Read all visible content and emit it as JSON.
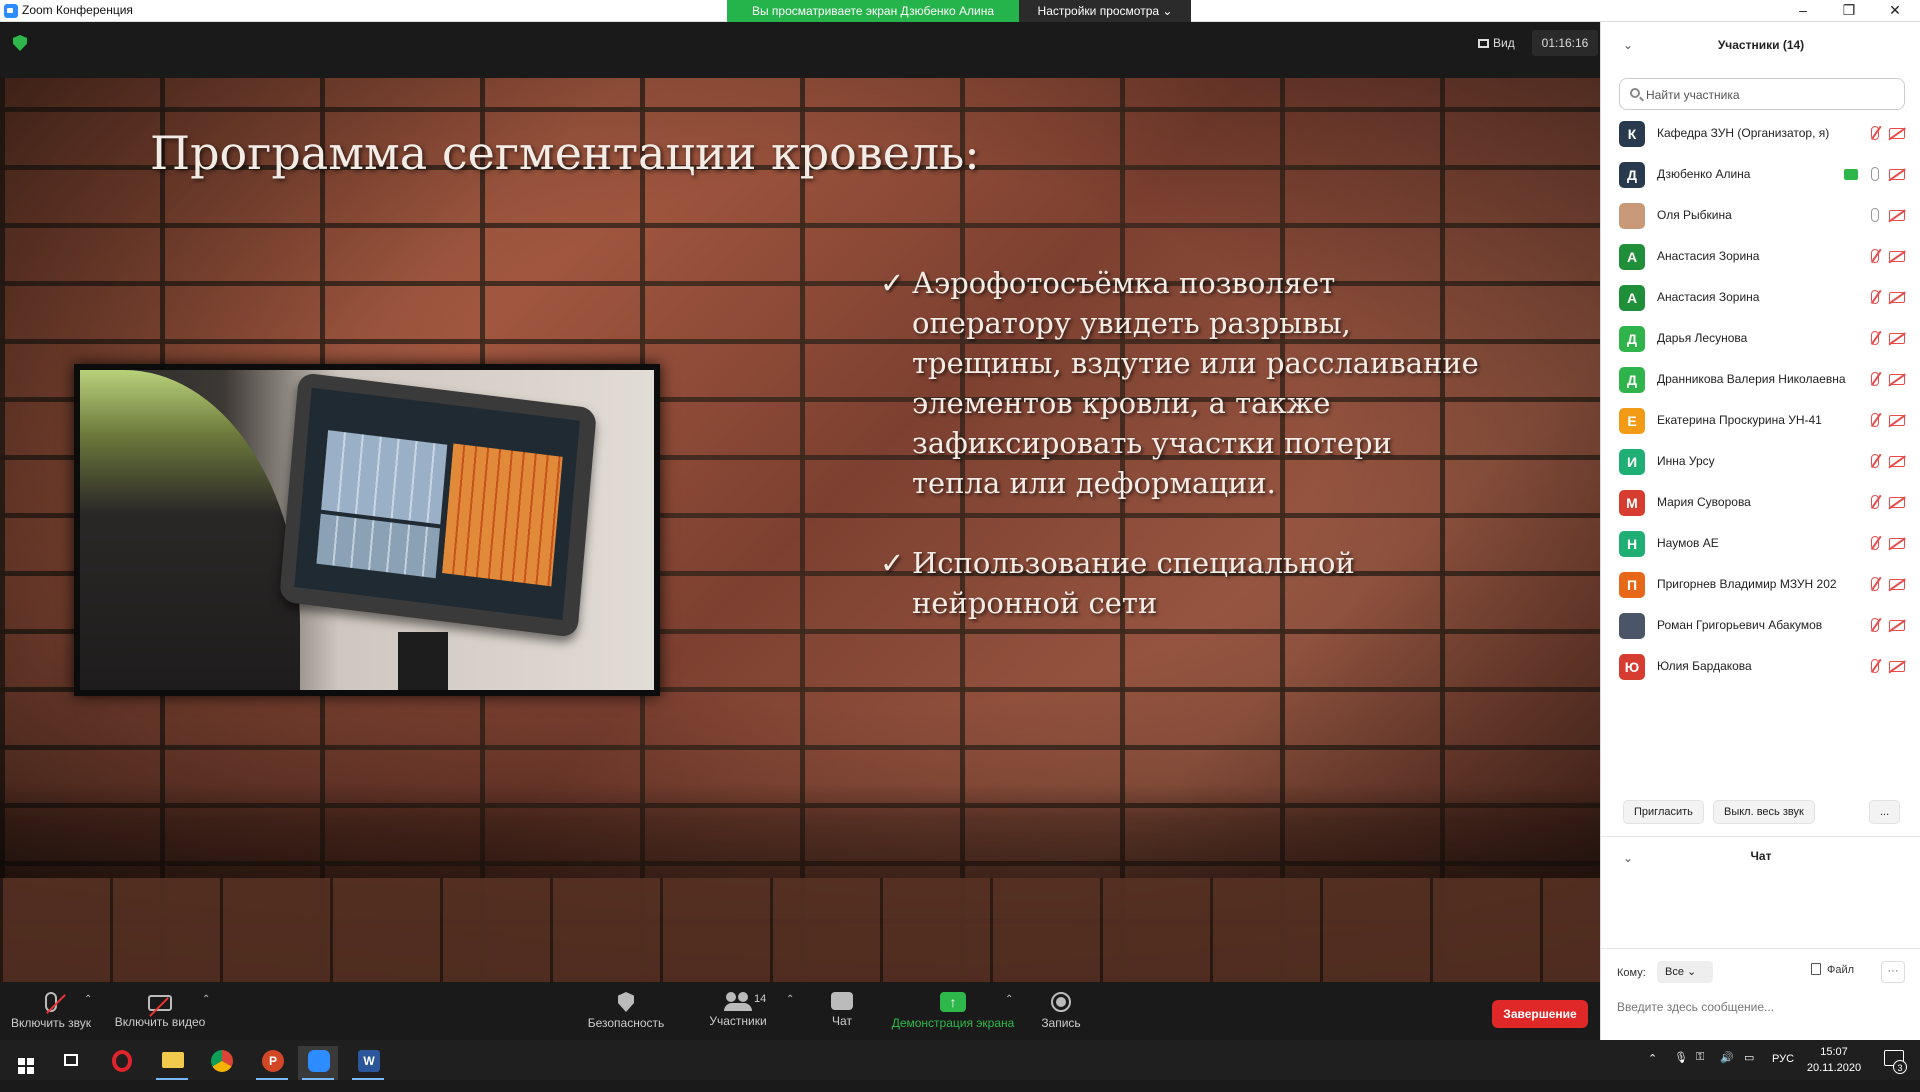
{
  "window": {
    "title": "Zoom Конференция"
  },
  "share_banner": {
    "status": "Вы просматриваете экран Дзюбенко Алина",
    "view_settings": "Настройки просмотра ⌄"
  },
  "meeting": {
    "view_label": "Вид",
    "timer": "01:16:16"
  },
  "slide": {
    "title": "Программа сегментации кровель:",
    "check_glyph": "✓",
    "bullets": [
      {
        "text": "Аэрофотосъёмка позволяет оператору увидеть разрывы, трещины, вздутие или расслаивание элементов кровли, а также зафиксировать участки потери тепла или деформации."
      },
      {
        "text": "Использование специальной нейронной сети"
      }
    ]
  },
  "toolbar": {
    "unmute": "Включить звук",
    "start_video": "Включить видео",
    "security": "Безопасность",
    "participants": "Участники",
    "participants_count": "14",
    "chat": "Чат",
    "share_screen": "Демонстрация экрана",
    "record": "Запись",
    "end": "Завершение"
  },
  "panel": {
    "title": "Участники (14)",
    "search_placeholder": "Найти участника",
    "participants": [
      {
        "initial": "К",
        "name": "Кафедра ЗУН (Организатор, я)",
        "color": "#2a3a4e",
        "mic": "muted"
      },
      {
        "initial": "Д",
        "name": "Дзюбенко Алина",
        "color": "#2a3a4e",
        "mic": "on",
        "sharing": true
      },
      {
        "initial": "",
        "name": "Оля Рыбкина",
        "color": "#c99a7a",
        "mic": "on"
      },
      {
        "initial": "А",
        "name": "Анастасия Зорина",
        "color": "#1f8f3a",
        "mic": "muted"
      },
      {
        "initial": "А",
        "name": "Анастасия Зорина",
        "color": "#1f8f3a",
        "mic": "muted"
      },
      {
        "initial": "Д",
        "name": "Дарья Лесунова",
        "color": "#2fb34b",
        "mic": "muted"
      },
      {
        "initial": "Д",
        "name": "Дранникова Валерия Николаевна",
        "color": "#2fb34b",
        "mic": "muted"
      },
      {
        "initial": "Е",
        "name": "Екатерина Проскурина УН-41",
        "color": "#f29b16",
        "mic": "muted"
      },
      {
        "initial": "И",
        "name": "Инна Урсу",
        "color": "#1fae73",
        "mic": "muted"
      },
      {
        "initial": "М",
        "name": "Мария Суворова",
        "color": "#d63c2f",
        "mic": "muted"
      },
      {
        "initial": "Н",
        "name": "Наумов АЕ",
        "color": "#1fae73",
        "mic": "muted"
      },
      {
        "initial": "П",
        "name": "Пригорнев Владимир МЗУН 202",
        "color": "#e8681a",
        "mic": "muted"
      },
      {
        "initial": "",
        "name": "Роман Григорьевич Абакумов",
        "color": "#4a5668",
        "mic": "muted"
      },
      {
        "initial": "Ю",
        "name": "Юлия Бардакова",
        "color": "#d63c2f",
        "mic": "muted"
      }
    ],
    "invite": "Пригласить",
    "mute_all": "Выкл. весь звук",
    "more": "..."
  },
  "chat": {
    "title": "Чат",
    "to_label": "Кому:",
    "to_value": "Все ⌄",
    "file": "Файл",
    "more": "···",
    "placeholder": "Введите здесь сообщение..."
  },
  "taskbar": {
    "lang": "РУС",
    "time": "15:07",
    "date": "20.11.2020",
    "notifications": "3"
  }
}
